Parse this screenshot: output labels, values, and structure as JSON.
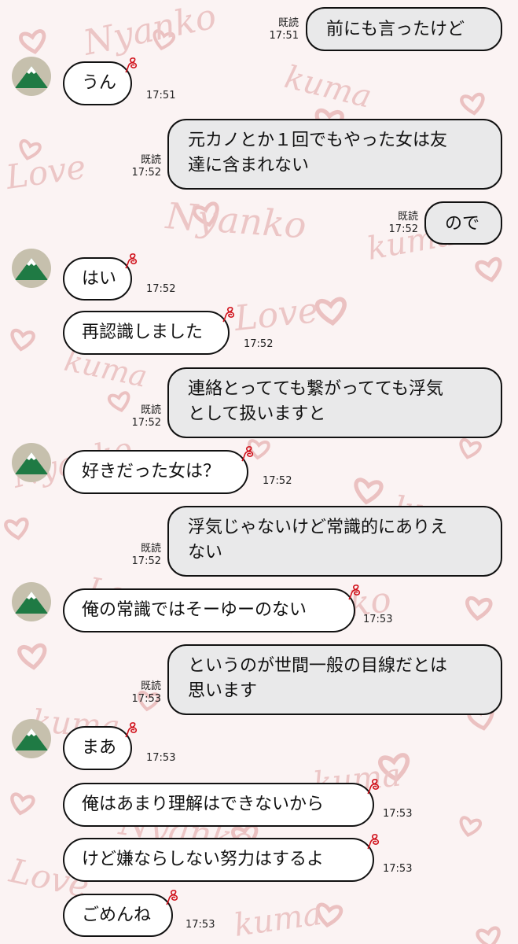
{
  "read_label": "既読",
  "messages": [
    {
      "side": "right",
      "text": "前にも言ったけど",
      "time": "17:51",
      "read": true
    },
    {
      "side": "left",
      "text": "うん",
      "time": "17:51",
      "avatar": true
    },
    {
      "side": "right",
      "lines": [
        "元カノとか１回でもやった女は友",
        "達に含まれない"
      ],
      "time": "17:52",
      "read": true
    },
    {
      "side": "right",
      "text": "ので",
      "time": "17:52",
      "read": true
    },
    {
      "side": "left",
      "text": "はい",
      "time": "17:52",
      "avatar": true
    },
    {
      "side": "left",
      "text": "再認識しました",
      "time": "17:52"
    },
    {
      "side": "right",
      "lines": [
        "連絡とってても繋がってても浮気",
        "として扱いますと"
      ],
      "time": "17:52",
      "read": true
    },
    {
      "side": "left",
      "text": "好きだった女は？",
      "time": "17:52",
      "avatar": true
    },
    {
      "side": "right",
      "lines": [
        "浮気じゃないけど常識的にありえ",
        "ない"
      ],
      "time": "17:52",
      "read": true
    },
    {
      "side": "left",
      "text": "俺の常識ではそーゆーのない",
      "time": "17:53",
      "avatar": true
    },
    {
      "side": "right",
      "lines": [
        "というのが世間一般の目線だとは",
        "思います"
      ],
      "time": "17:53",
      "read": true
    },
    {
      "side": "left",
      "text": "まあ",
      "time": "17:53",
      "avatar": true
    },
    {
      "side": "left",
      "text": "俺はあまり理解はできないから",
      "time": "17:53"
    },
    {
      "side": "left",
      "text": "けど嫌ならしない努力はするよ",
      "time": "17:53"
    },
    {
      "side": "left",
      "text": "ごめんね",
      "time": "17:53"
    }
  ],
  "colors": {
    "background": "#fbf3f3",
    "pattern": "#e9b8b8",
    "right_bubble": "#e9e9ea",
    "left_bubble": "#ffffff",
    "tail_heart": "#d0101a",
    "avatar_bg": "#c6c0ad",
    "avatar_mountain": "#1f7a44"
  },
  "background_text": [
    "Love",
    "Nyanko",
    "kuma"
  ]
}
